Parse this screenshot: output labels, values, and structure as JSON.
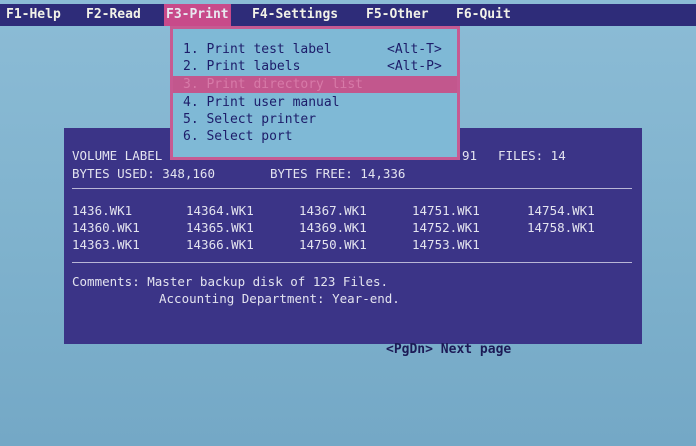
{
  "menubar": {
    "items": [
      {
        "label": "F1-Help"
      },
      {
        "label": "F2-Read"
      },
      {
        "label": "F3-Print"
      },
      {
        "label": "F4-Settings"
      },
      {
        "label": "F5-Other"
      },
      {
        "label": "F6-Quit"
      }
    ]
  },
  "print_menu": {
    "items": [
      {
        "label": "1. Print test label",
        "shortcut": "<Alt-T>"
      },
      {
        "label": "2. Print labels",
        "shortcut": "<Alt-P>"
      },
      {
        "label": "3. Print directory list",
        "shortcut": ""
      },
      {
        "label": "4. Print user manual",
        "shortcut": ""
      },
      {
        "label": "5. Select printer",
        "shortcut": ""
      },
      {
        "label": "6. Select port",
        "shortcut": ""
      }
    ]
  },
  "disk_info": {
    "volume_label": "VOLUME LABEL",
    "volume_right": "91",
    "files": "FILES: 14",
    "bytes_used": "BYTES USED: 348,160",
    "bytes_free": "BYTES FREE: 14,336"
  },
  "files": [
    "1436.WK1",
    "14364.WK1",
    "14367.WK1",
    "14751.WK1",
    "14754.WK1",
    "14360.WK1",
    "14365.WK1",
    "14369.WK1",
    "14752.WK1",
    "14758.WK1",
    "14363.WK1",
    "14366.WK1",
    "14750.WK1",
    "14753.WK1"
  ],
  "comments": {
    "line1": "Comments: Master backup disk of 123 Files.",
    "line2": "Accounting Department: Year-end."
  },
  "footer": {
    "next_page": "<PgDn> Next page"
  },
  "colors": {
    "menubar_bg": "#2e2c79",
    "menu_highlight": "#c84a8a",
    "panel_bg": "#3b3487",
    "screen_bg": "#7fb3cf"
  }
}
